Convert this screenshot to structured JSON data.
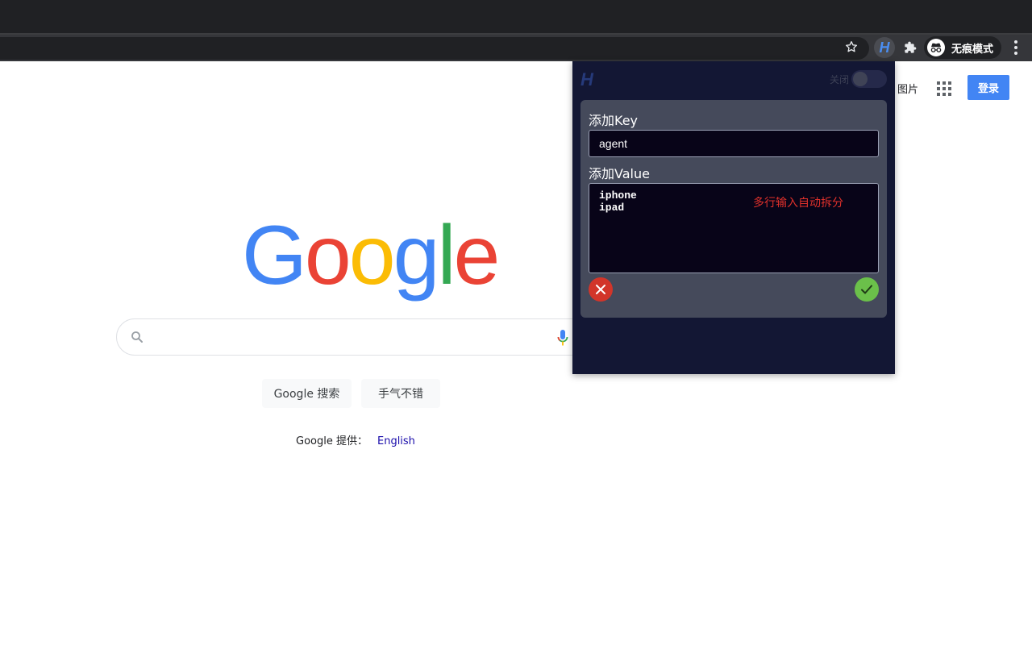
{
  "browser": {
    "incognito_label": "无痕模式",
    "extension_letter": "H"
  },
  "google": {
    "images_link": "图片",
    "login_button": "登录",
    "logo_letters": [
      {
        "char": "G",
        "color": "#4285f4"
      },
      {
        "char": "o",
        "color": "#ea4335"
      },
      {
        "char": "o",
        "color": "#fbbc05"
      },
      {
        "char": "g",
        "color": "#4285f4"
      },
      {
        "char": "l",
        "color": "#34a853"
      },
      {
        "char": "e",
        "color": "#ea4335"
      }
    ],
    "search_button": "Google 搜索",
    "lucky_button": "手气不错",
    "offered_by": "Google 提供：",
    "offered_language": "English"
  },
  "popup": {
    "logo": "H",
    "toggle_label": "关闭",
    "toggle_on": false,
    "key_label": "添加Key",
    "key_value": "agent",
    "value_label": "添加Value",
    "value_lines": [
      "iphone",
      "ipad"
    ],
    "hint": "多行输入自动拆分",
    "colors": {
      "background": "#131734",
      "card": "#454a5b",
      "cancel": "#d2352a",
      "confirm": "#6bc04a",
      "hint": "#e0312b"
    }
  }
}
